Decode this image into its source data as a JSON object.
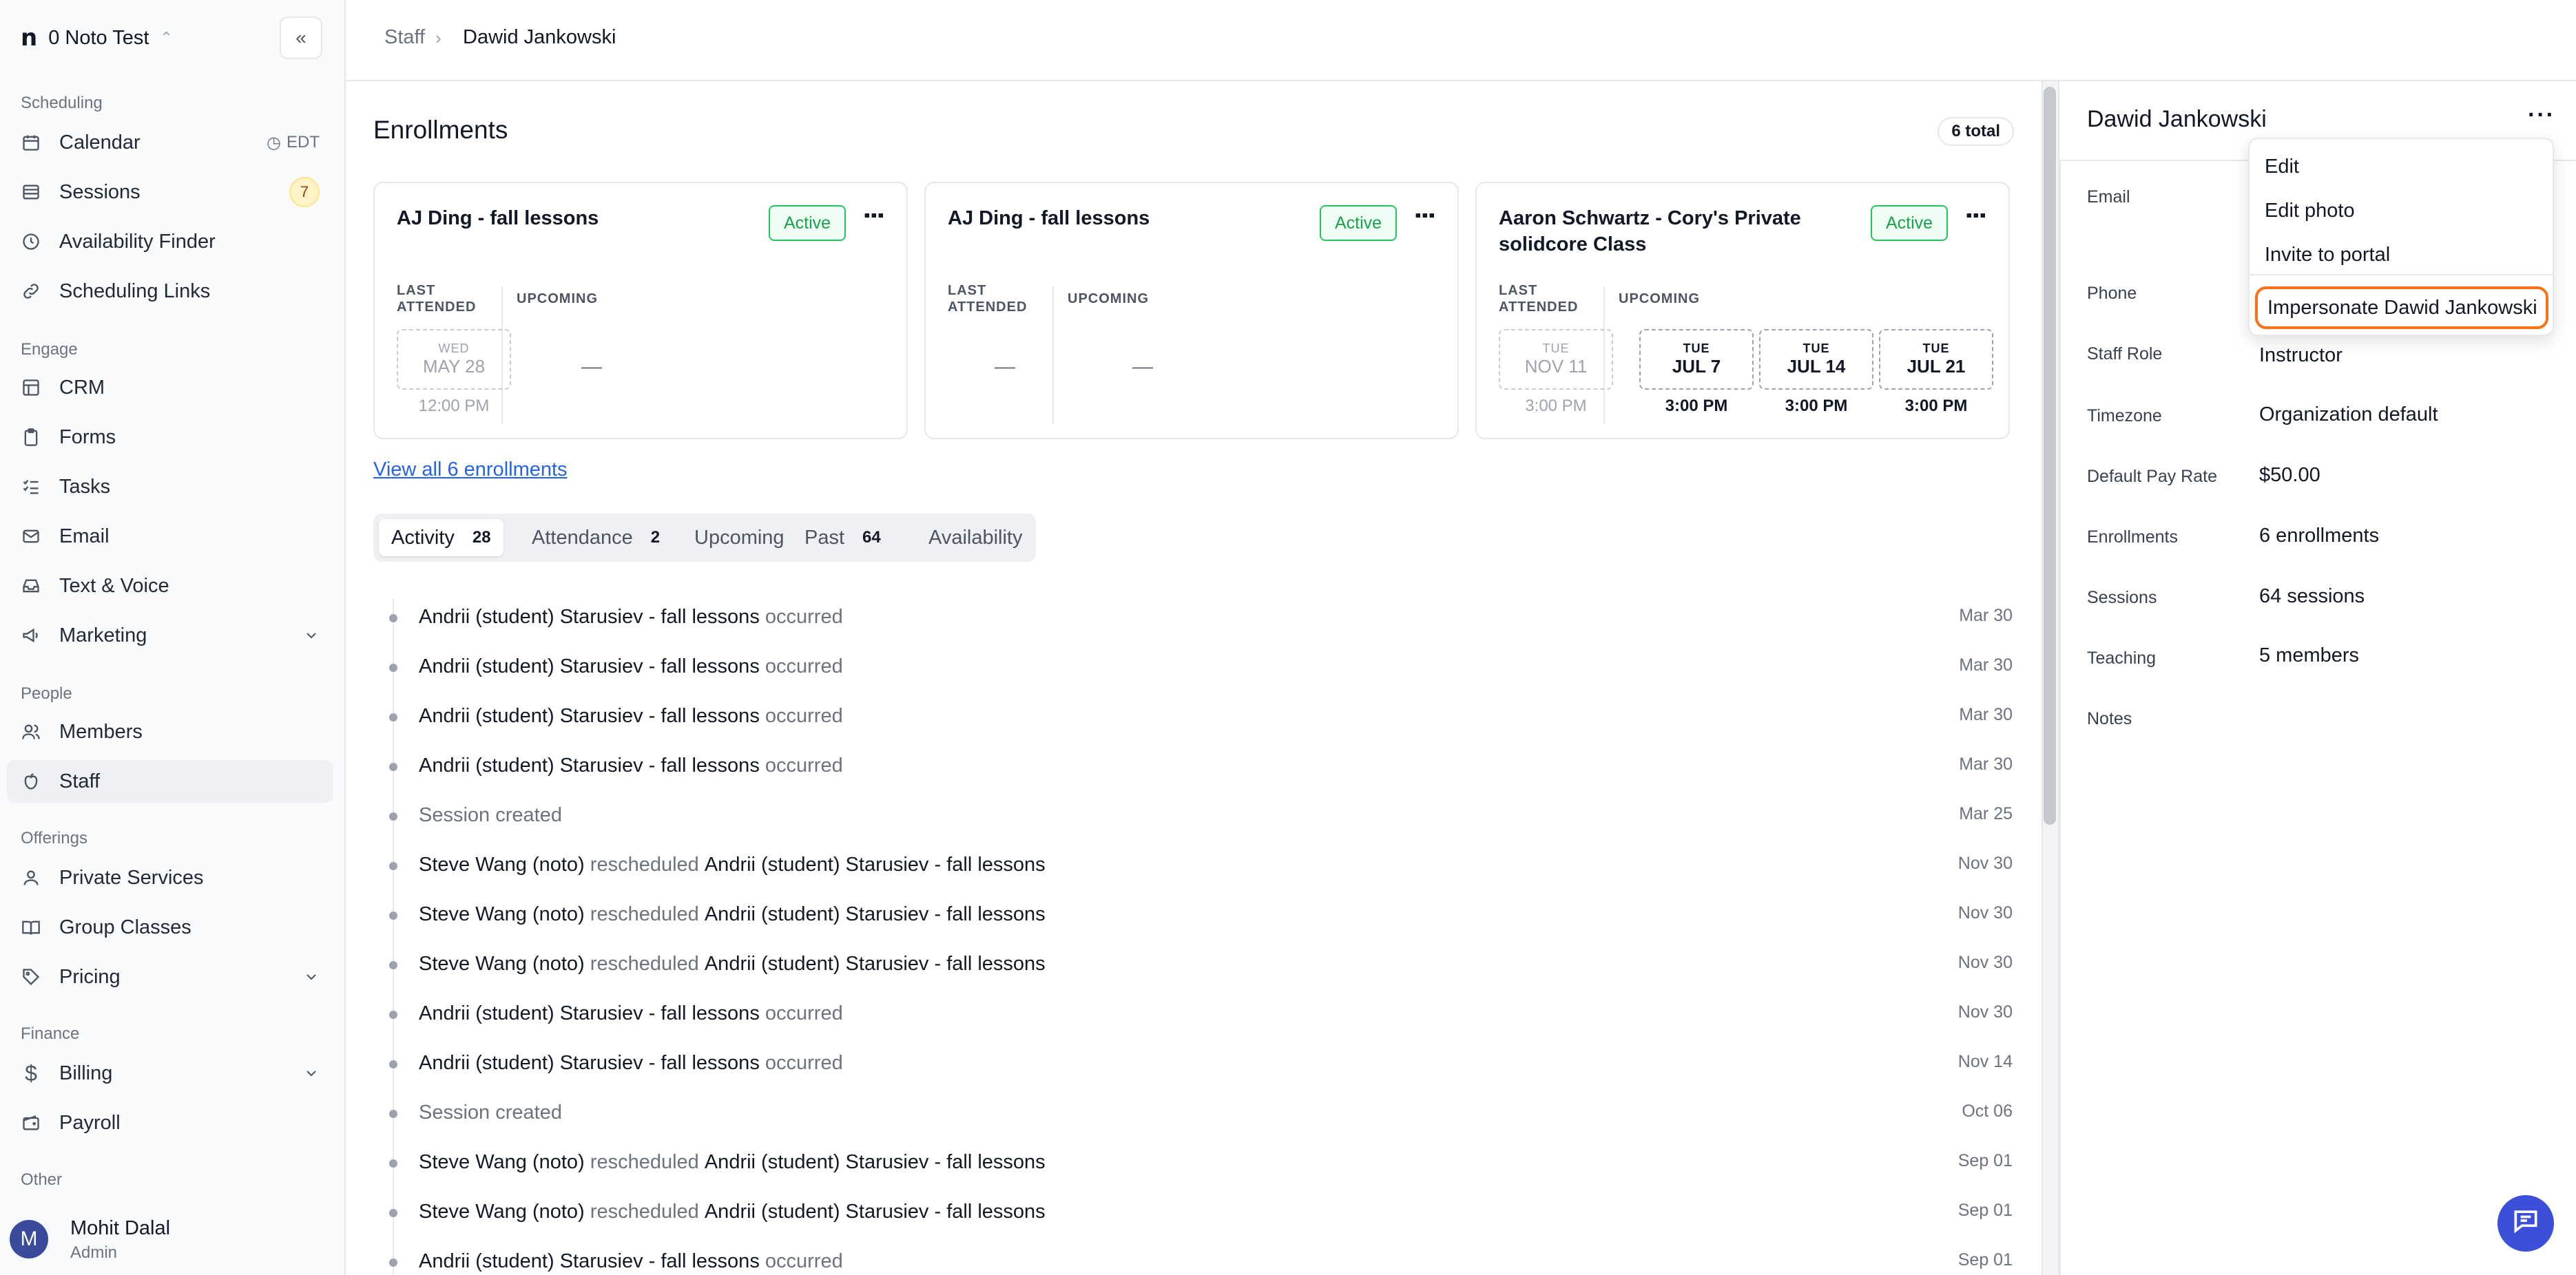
{
  "sidebar": {
    "org_name": "0 Noto Test",
    "sections": {
      "scheduling": "Scheduling",
      "engage": "Engage",
      "people": "People",
      "offerings": "Offerings",
      "finance": "Finance",
      "other": "Other"
    },
    "items": {
      "calendar": "Calendar",
      "calendar_tz": "EDT",
      "sessions": "Sessions",
      "sessions_badge": "7",
      "availability_finder": "Availability Finder",
      "scheduling_links": "Scheduling Links",
      "crm": "CRM",
      "forms": "Forms",
      "tasks": "Tasks",
      "email": "Email",
      "text_voice": "Text & Voice",
      "marketing": "Marketing",
      "members": "Members",
      "staff": "Staff",
      "private_services": "Private Services",
      "group_classes": "Group Classes",
      "pricing": "Pricing",
      "billing": "Billing",
      "payroll": "Payroll"
    },
    "user": {
      "initial": "M",
      "name": "Mohit Dalal",
      "role": "Admin"
    }
  },
  "breadcrumb": {
    "parent": "Staff",
    "current": "Dawid Jankowski"
  },
  "enrollments": {
    "heading": "Enrollments",
    "total": "6 total",
    "view_all": "View all 6 enrollments",
    "labels": {
      "last_attended_1": "LAST",
      "last_attended_2": "ATTENDED",
      "upcoming": "UPCOMING"
    },
    "cards": [
      {
        "title": "AJ Ding - fall lessons",
        "status": "Active",
        "last": {
          "dow": "WED",
          "day": "MAY 28",
          "time": "12:00 PM"
        },
        "upcoming_empty": "—"
      },
      {
        "title": "AJ Ding - fall lessons",
        "status": "Active",
        "last_empty": "—",
        "upcoming_empty": "—"
      },
      {
        "title": "Aaron Schwartz - Cory's Private solidcore Class",
        "status": "Active",
        "last": {
          "dow": "TUE",
          "day": "NOV 11",
          "time": "3:00 PM"
        },
        "upcoming": [
          {
            "dow": "TUE",
            "day": "JUL 7",
            "time": "3:00 PM"
          },
          {
            "dow": "TUE",
            "day": "JUL 14",
            "time": "3:00 PM"
          },
          {
            "dow": "TUE",
            "day": "JUL 21",
            "time": "3:00 PM"
          }
        ]
      }
    ]
  },
  "tabs": [
    {
      "label": "Activity",
      "count": "28"
    },
    {
      "label": "Attendance",
      "count": "2"
    },
    {
      "label": "Upcoming",
      "count": ""
    },
    {
      "label": "Past",
      "count": "64"
    },
    {
      "label": "Availability",
      "count": ""
    }
  ],
  "activity": [
    {
      "a": "Andrii (student) Starusiev - fall lessons",
      "verb": "occurred",
      "b": "",
      "date": "Mar 30"
    },
    {
      "a": "Andrii (student) Starusiev - fall lessons",
      "verb": "occurred",
      "b": "",
      "date": "Mar 30"
    },
    {
      "a": "Andrii (student) Starusiev - fall lessons",
      "verb": "occurred",
      "b": "",
      "date": "Mar 30"
    },
    {
      "a": "Andrii (student) Starusiev - fall lessons",
      "verb": "occurred",
      "b": "",
      "date": "Mar 30"
    },
    {
      "a": "",
      "verb": "Session created",
      "b": "",
      "date": "Mar 25"
    },
    {
      "a": "Steve Wang (noto)",
      "verb": "rescheduled",
      "b": "Andrii (student) Starusiev - fall lessons",
      "date": "Nov 30"
    },
    {
      "a": "Steve Wang (noto)",
      "verb": "rescheduled",
      "b": "Andrii (student) Starusiev - fall lessons",
      "date": "Nov 30"
    },
    {
      "a": "Steve Wang (noto)",
      "verb": "rescheduled",
      "b": "Andrii (student) Starusiev - fall lessons",
      "date": "Nov 30"
    },
    {
      "a": "Andrii (student) Starusiev - fall lessons",
      "verb": "occurred",
      "b": "",
      "date": "Nov 30"
    },
    {
      "a": "Andrii (student) Starusiev - fall lessons",
      "verb": "occurred",
      "b": "",
      "date": "Nov 14"
    },
    {
      "a": "",
      "verb": "Session created",
      "b": "",
      "date": "Oct 06"
    },
    {
      "a": "Steve Wang (noto)",
      "verb": "rescheduled",
      "b": "Andrii (student) Starusiev - fall lessons",
      "date": "Sep 01"
    },
    {
      "a": "Steve Wang (noto)",
      "verb": "rescheduled",
      "b": "Andrii (student) Starusiev - fall lessons",
      "date": "Sep 01"
    },
    {
      "a": "Andrii (student) Starusiev - fall lessons",
      "verb": "occurred",
      "b": "",
      "date": "Sep 01"
    }
  ],
  "panel": {
    "name": "Dawid Jankowski",
    "fields": {
      "email_label": "Email",
      "phone_label": "Phone",
      "role_label": "Staff Role",
      "role_value": "Instructor",
      "tz_label": "Timezone",
      "tz_value": "Organization default",
      "pay_label": "Default Pay Rate",
      "pay_value": "$50.00",
      "enroll_label": "Enrollments",
      "enroll_value": "6 enrollments",
      "sessions_label": "Sessions",
      "sessions_value": "64 sessions",
      "teaching_label": "Teaching",
      "teaching_value": "5 members",
      "notes_label": "Notes"
    }
  },
  "menu": {
    "edit": "Edit",
    "edit_photo": "Edit photo",
    "invite": "Invite to portal",
    "impersonate": "Impersonate Dawid Jankowski"
  },
  "colors": {
    "active_green": "#16a34a",
    "highlight_orange": "#f97316",
    "link_blue": "#2563eb",
    "fab_blue": "#3b4fd8"
  }
}
